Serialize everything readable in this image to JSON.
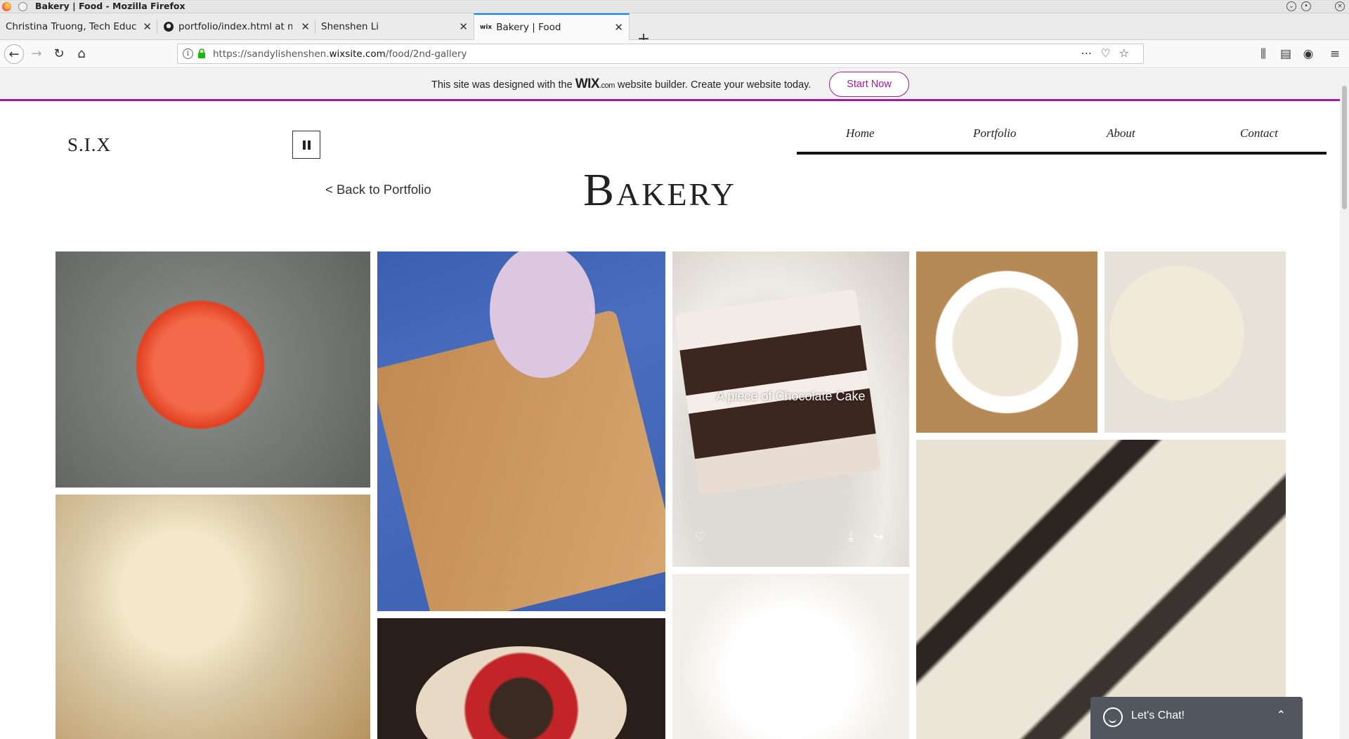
{
  "window": {
    "title": "Bakery | Food - Mozilla Firefox"
  },
  "tabs": [
    {
      "label": "Christina Truong, Tech Educat",
      "active": false
    },
    {
      "label": "portfolio/index.html at ma",
      "active": false
    },
    {
      "label": "Shenshen Li",
      "active": false
    },
    {
      "label": "Bakery | Food",
      "active": true
    }
  ],
  "address": {
    "prefix": "https://sandylishenshen.",
    "domain": "wixsite.com",
    "path": "/food/2nd-gallery"
  },
  "wix_banner": {
    "text_before": "This site was designed with the",
    "logo": "WIX",
    "logo_suffix": ".com",
    "text_after": "website builder. Create your website today.",
    "button": "Start Now",
    "accent": "#a21b9b"
  },
  "site": {
    "logo": "S.I.X",
    "menu": [
      "Home",
      "Portfolio",
      "About",
      "Contact"
    ],
    "back_link": "< Back to Portfolio",
    "page_title": "Bakery"
  },
  "gallery": {
    "hover_title": "A piece of Chocolate Cake",
    "items": [
      {
        "name": "marble-mousse-photo",
        "colors": [
          "#7e8380",
          "#e24a2a"
        ]
      },
      {
        "name": "owl-heart-cookies-photo",
        "colors": [
          "#3a5fb0",
          "#c08a52"
        ]
      },
      {
        "name": "chocolate-cake-photo",
        "colors": [
          "#e8e3de",
          "#3b2620"
        ]
      },
      {
        "name": "almond-cake-photo",
        "colors": [
          "#b68a56",
          "#f0e6d8"
        ]
      },
      {
        "name": "almond-cake-slice-photo",
        "colors": [
          "#e7e2d9",
          "#f2ead9"
        ]
      },
      {
        "name": "heart-cookies-pile-photo",
        "colors": [
          "#d9c9a7",
          "#b7935e"
        ]
      },
      {
        "name": "strawberry-cake-photo",
        "colors": [
          "#2a1e1a",
          "#c22428"
        ]
      },
      {
        "name": "almond-dessert-photo",
        "colors": [
          "#f2efe9",
          "#e1d1b4"
        ]
      },
      {
        "name": "nougat-closeup-photo",
        "colors": [
          "#e9e2d4",
          "#2b2622"
        ]
      }
    ]
  },
  "chat": {
    "label": "Let's Chat!"
  }
}
